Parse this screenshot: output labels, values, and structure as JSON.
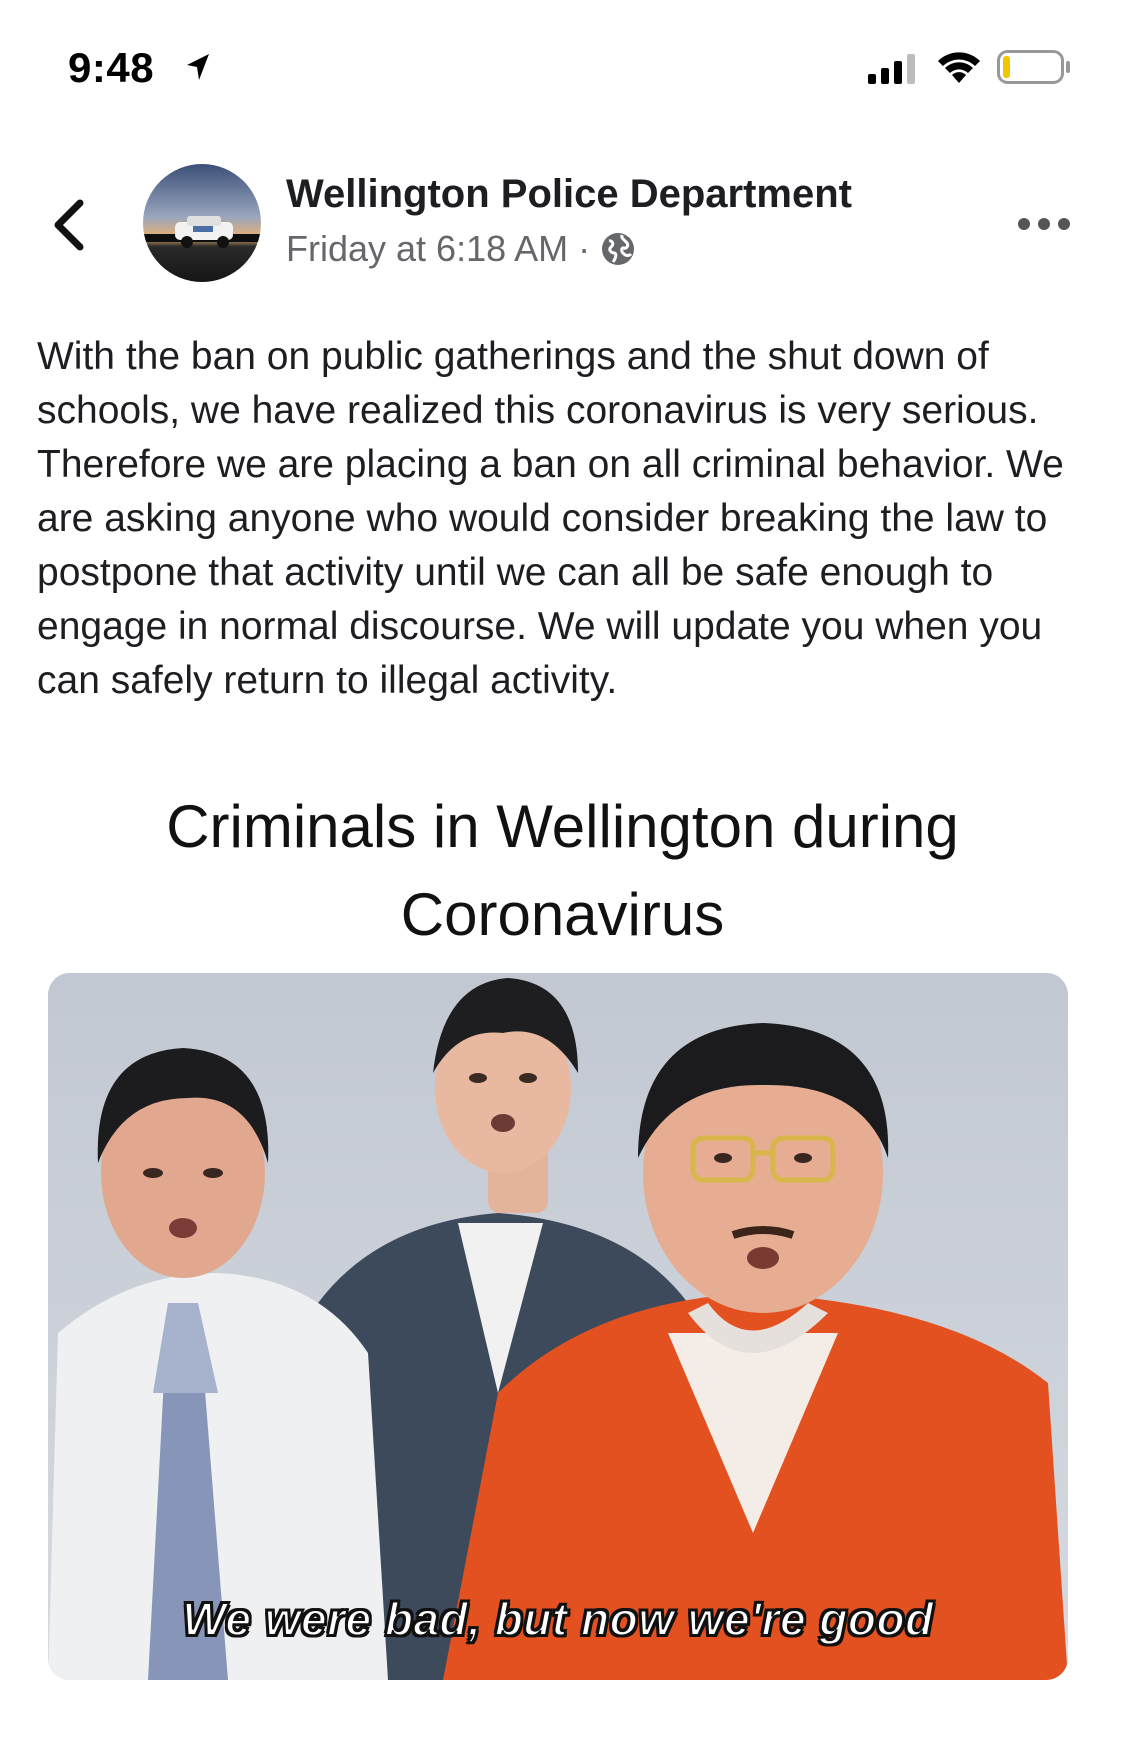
{
  "status_bar": {
    "time": "9:48",
    "icons": [
      "location-arrow-icon",
      "cellular-signal-icon",
      "wifi-icon",
      "battery-icon"
    ],
    "battery_level_fraction": 0.12,
    "battery_color": "#f5c400"
  },
  "header": {
    "back_icon": "chevron-left-icon",
    "page_name": "Wellington Police Department",
    "timestamp": "Friday at 6:18 AM",
    "separator": "·",
    "audience_icon": "globe-icon",
    "more_icon": "more-horizontal-icon"
  },
  "post": {
    "text": "With the ban on public gatherings and the shut down of schools, we have realized this coronavirus is very serious. Therefore we are placing a ban on all criminal behavior. We are asking anyone who would consider breaking the law to postpone that activity until we can all be safe enough to engage in normal discourse. We will update you when you can safely return to illegal activity."
  },
  "meme": {
    "caption": "Criminals in Wellington during Coronavirus",
    "subtitle": "We were bad, but now we're good"
  },
  "colors": {
    "name_text": "#1c1e21",
    "meta_text": "#65676b",
    "background": "#ffffff"
  }
}
